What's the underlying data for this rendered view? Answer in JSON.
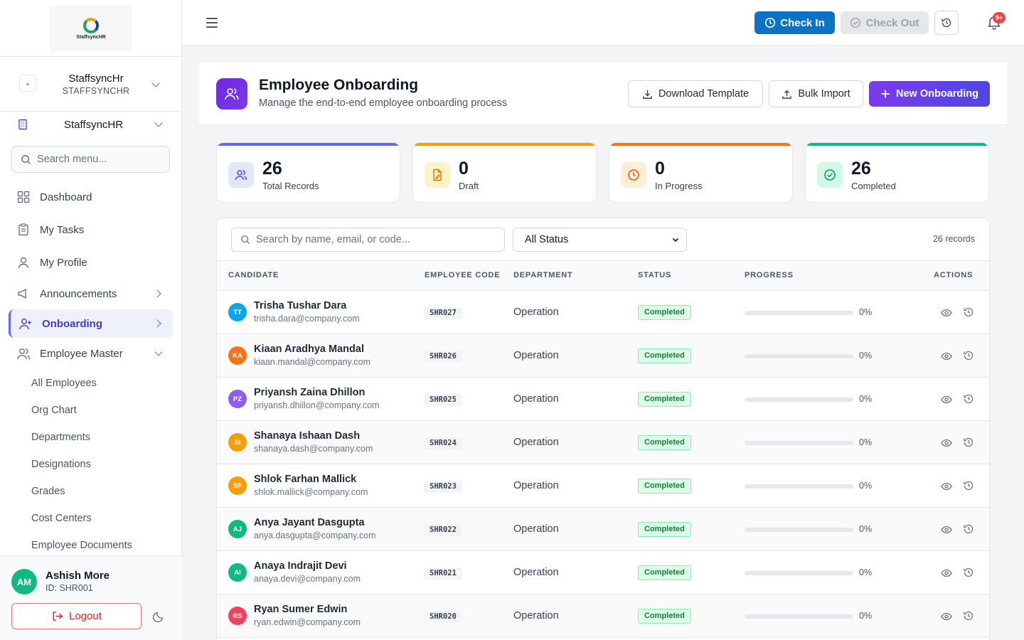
{
  "sidebar": {
    "logo_text": "StaffsyncHR",
    "org": {
      "name": "StaffsyncHr",
      "code": "STAFFSYNCHR"
    },
    "company": "StaffsyncHR",
    "search_placeholder": "Search menu...",
    "nav": [
      {
        "label": "Dashboard",
        "icon": "dashboard-icon"
      },
      {
        "label": "My Tasks",
        "icon": "clipboard-icon"
      },
      {
        "label": "My Profile",
        "icon": "user-icon"
      },
      {
        "label": "Announcements",
        "icon": "megaphone-icon"
      },
      {
        "label": "Onboarding",
        "icon": "user-plus-icon",
        "active": true
      },
      {
        "label": "Employee Master",
        "icon": "users-icon"
      }
    ],
    "sub_items": [
      "All Employees",
      "Org Chart",
      "Departments",
      "Designations",
      "Grades",
      "Cost Centers",
      "Employee Documents"
    ],
    "user": {
      "initials": "AM",
      "name": "Ashish More",
      "id": "ID: SHR001"
    },
    "logout_label": "Logout"
  },
  "topbar": {
    "checkin_label": "Check In",
    "checkout_label": "Check Out",
    "notification_badge": "9+"
  },
  "header": {
    "title": "Employee Onboarding",
    "subtitle": "Manage the end-to-end employee onboarding process",
    "download_label": "Download Template",
    "import_label": "Bulk Import",
    "new_label": "New Onboarding"
  },
  "stats": [
    {
      "value": "26",
      "label": "Total Records",
      "color": "#6366f1",
      "icon": "users-icon"
    },
    {
      "value": "0",
      "label": "Draft",
      "color": "#f59e0b",
      "icon": "file-edit-icon"
    },
    {
      "value": "0",
      "label": "In Progress",
      "color": "#f97316",
      "icon": "clock-icon"
    },
    {
      "value": "26",
      "label": "Completed",
      "color": "#10b981",
      "icon": "check-circle-icon"
    }
  ],
  "table": {
    "search_placeholder": "Search by name, email, or code...",
    "status_filter": "All Status",
    "record_count": "26 records",
    "columns": [
      "CANDIDATE",
      "EMPLOYEE CODE",
      "DEPARTMENT",
      "STATUS",
      "PROGRESS",
      "ACTIONS"
    ],
    "rows": [
      {
        "initials": "TT",
        "avatar_color": "#0ea5e9",
        "name": "Trisha Tushar Dara",
        "email": "trisha.dara@company.com",
        "code": "SHR027",
        "department": "Operation",
        "status": "Completed",
        "progress": 0,
        "progress_text": "0%"
      },
      {
        "initials": "KA",
        "avatar_color": "#f97316",
        "name": "Kiaan Aradhya Mandal",
        "email": "kiaan.mandal@company.com",
        "code": "SHR026",
        "department": "Operation",
        "status": "Completed",
        "progress": 0,
        "progress_text": "0%"
      },
      {
        "initials": "PZ",
        "avatar_color": "#8b5cf6",
        "name": "Priyansh Zaina Dhillon",
        "email": "priyansh.dhillon@company.com",
        "code": "SHR025",
        "department": "Operation",
        "status": "Completed",
        "progress": 0,
        "progress_text": "0%"
      },
      {
        "initials": "SI",
        "avatar_color": "#f59e0b",
        "name": "Shanaya Ishaan Dash",
        "email": "shanaya.dash@company.com",
        "code": "SHR024",
        "department": "Operation",
        "status": "Completed",
        "progress": 0,
        "progress_text": "0%"
      },
      {
        "initials": "SF",
        "avatar_color": "#f59e0b",
        "name": "Shlok Farhan Mallick",
        "email": "shlok.mallick@company.com",
        "code": "SHR023",
        "department": "Operation",
        "status": "Completed",
        "progress": 0,
        "progress_text": "0%"
      },
      {
        "initials": "AJ",
        "avatar_color": "#10b981",
        "name": "Anya Jayant Dasgupta",
        "email": "anya.dasgupta@company.com",
        "code": "SHR022",
        "department": "Operation",
        "status": "Completed",
        "progress": 0,
        "progress_text": "0%"
      },
      {
        "initials": "AI",
        "avatar_color": "#10b981",
        "name": "Anaya Indrajit Devi",
        "email": "anaya.devi@company.com",
        "code": "SHR021",
        "department": "Operation",
        "status": "Completed",
        "progress": 0,
        "progress_text": "0%"
      },
      {
        "initials": "RS",
        "avatar_color": "#f43f5e",
        "name": "Ryan Sumer Edwin",
        "email": "ryan.edwin@company.com",
        "code": "SHR020",
        "department": "Operation",
        "status": "Completed",
        "progress": 0,
        "progress_text": "0%"
      }
    ]
  }
}
